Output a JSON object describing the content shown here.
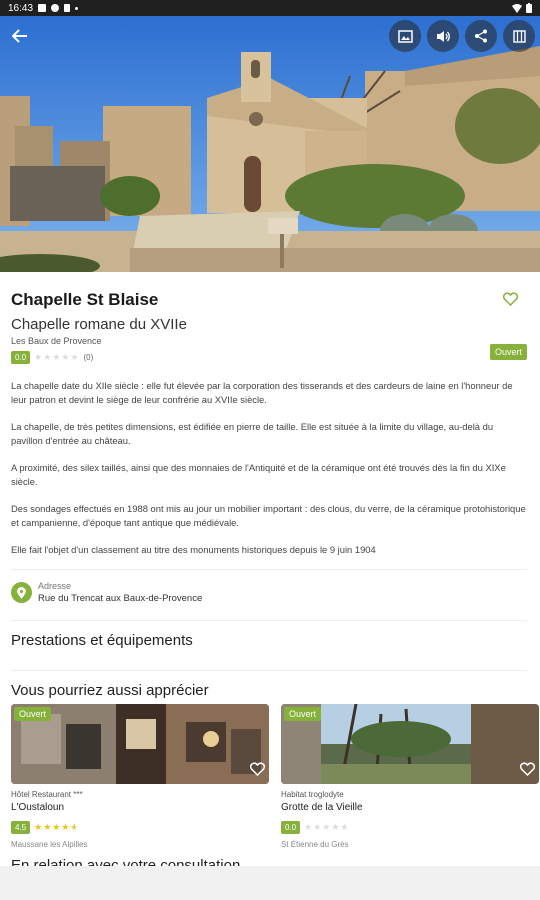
{
  "status": {
    "time": "16:43"
  },
  "place": {
    "title": "Chapelle St Blaise",
    "subtitle": "Chapelle romane du XVIIe",
    "locality": "Les Baux de Provence",
    "score": "0.0",
    "rating_stars": 0,
    "review_count": "(0)",
    "open_status": "Ouvert",
    "paragraphs": [
      "La chapelle date du XIIe siècle : elle fut élevée par la corporation des tisserands et des cardeurs de laine en l'honneur de leur patron et devint le siège de leur confrérie au XVIIe siècle.",
      "La chapelle, de très petites dimensions, est édifiée en pierre de taille. Elle est située à la limite du village, au-delà du pavillon d'entrée au château.",
      "A proximité, des silex taillés, ainsi que des monnaies de l'Antiquité et de la céramique ont été trouvés dès la fin du XIXe siècle.",
      "Des sondages effectués en 1988 ont mis au jour un mobilier important : des clous, du verre, de la céramique protohistorique et campanienne, d'époque tant antique que médiévale.",
      "Elle fait l'objet d'un classement au titre des monuments historiques depuis le 9 juin 1904"
    ]
  },
  "address": {
    "label": "Adresse",
    "value": "Rue du Trencat aux Baux-de-Provence"
  },
  "sections": {
    "services": "Prestations et équipements",
    "suggestions": "Vous pourriez aussi apprécier",
    "related": "En relation avec votre consultation"
  },
  "cards": [
    {
      "open": "Ouvert",
      "type": "Hôtel Restaurant ***",
      "name": "L'Oustaloun",
      "score": "4.5",
      "stars": 4.5,
      "town": "Maussane les Alpilles"
    },
    {
      "open": "Ouvert",
      "type": "Habitat troglodyte",
      "name": "Grotte de la Vieille",
      "score": "0.0",
      "stars": 0,
      "town": "St Étienne du Grès"
    }
  ],
  "icons": [
    "back-arrow-icon",
    "gallery-icon",
    "volume-icon",
    "share-icon",
    "map-icon",
    "heart-icon",
    "location-pin-icon"
  ],
  "colors": {
    "accent": "#86b13b",
    "star": "#f1c40f"
  }
}
